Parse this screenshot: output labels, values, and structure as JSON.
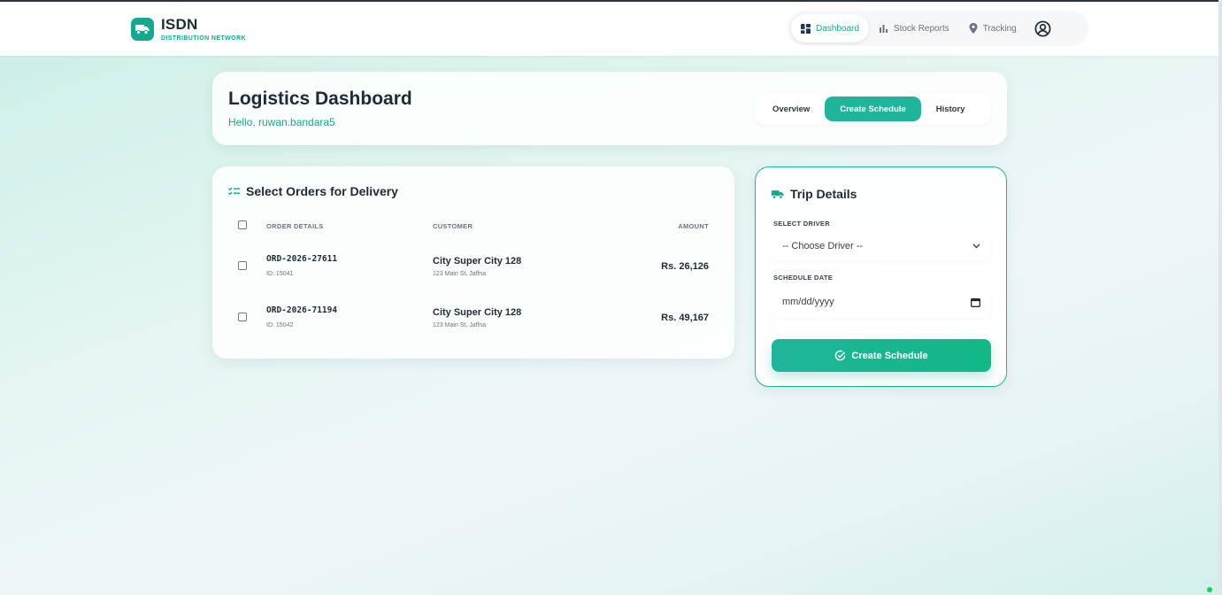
{
  "brand": {
    "name": "ISDN",
    "subtitle": "DISTRIBUTION NETWORK",
    "logo_icon": "truck-icon"
  },
  "nav": {
    "items": [
      {
        "label": "Dashboard",
        "icon": "dashboard-icon",
        "active": true
      },
      {
        "label": "Stock Reports",
        "icon": "bar-chart-icon",
        "active": false
      },
      {
        "label": "Tracking",
        "icon": "location-pin-icon",
        "active": false
      }
    ],
    "profile_icon": "user-circle-icon"
  },
  "page": {
    "title": "Logistics Dashboard",
    "greeting": "Hello, ruwan.bandara5",
    "tabs": [
      {
        "label": "Overview",
        "active": false
      },
      {
        "label": "Create Schedule",
        "active": true
      },
      {
        "label": "History",
        "active": false
      }
    ]
  },
  "orders": {
    "heading": "Select Orders for Delivery",
    "columns": {
      "details": "ORDER DETAILS",
      "customer": "CUSTOMER",
      "amount": "AMOUNT"
    },
    "rows": [
      {
        "order_no": "ORD-2026-27611",
        "id": "ID: 15041",
        "customer": "City Super City 128",
        "address": "123 Main St, Jaffna",
        "amount": "Rs. 26,126",
        "checked": false
      },
      {
        "order_no": "ORD-2026-71194",
        "id": "ID: 15042",
        "customer": "City Super City 128",
        "address": "123 Main St, Jaffna",
        "amount": "Rs. 49,167",
        "checked": false
      }
    ]
  },
  "trip": {
    "heading": "Trip Details",
    "driver_label": "SELECT DRIVER",
    "driver_value": "-- Choose Driver --",
    "date_label": "SCHEDULE DATE",
    "date_placeholder": "mm/dd/yyyy",
    "button_label": "Create Schedule"
  },
  "colors": {
    "accent": "#14a88e",
    "accent_button": "#1fb59b",
    "text_dark": "#1f2a37"
  }
}
